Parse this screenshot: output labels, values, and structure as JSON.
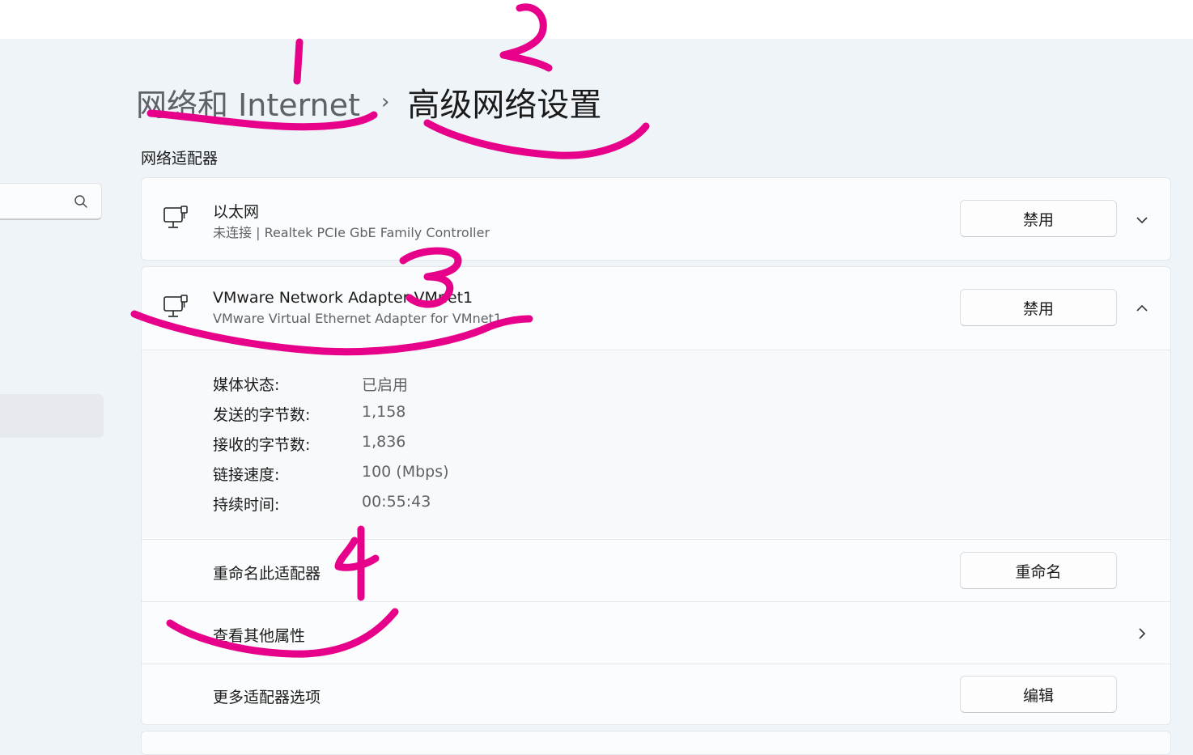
{
  "breadcrumb": {
    "parent": "网络和 Internet",
    "separator": "›",
    "current": "高级网络设置"
  },
  "section_label": "网络适配器",
  "adapters": [
    {
      "name": "以太网",
      "description": "未连接 | Realtek PCIe GbE Family Controller",
      "button_label": "禁用",
      "expanded": false
    },
    {
      "name": "VMware Network Adapter VMnet1",
      "description": "VMware Virtual Ethernet Adapter for VMnet1",
      "button_label": "禁用",
      "expanded": true,
      "details": [
        {
          "label": "媒体状态:",
          "value": "已启用"
        },
        {
          "label": "发送的字节数:",
          "value": "1,158"
        },
        {
          "label": "接收的字节数:",
          "value": "1,836"
        },
        {
          "label": "链接速度:",
          "value": "100 (Mbps)"
        },
        {
          "label": "持续时间:",
          "value": "00:55:43"
        }
      ],
      "actions": {
        "rename_label": "重命名此适配器",
        "rename_button": "重命名",
        "view_properties_label": "查看其他属性",
        "more_options_label": "更多适配器选项",
        "edit_button": "编辑"
      }
    }
  ],
  "annotations": [
    "1",
    "2",
    "3",
    "4"
  ],
  "colors": {
    "annotation": "#e6008a",
    "background": "#eff4f9",
    "card": "#fbfcfd"
  },
  "icons": [
    "search-icon",
    "ethernet-adapter-icon",
    "chevron-down-icon",
    "chevron-up-icon",
    "chevron-right-icon"
  ]
}
